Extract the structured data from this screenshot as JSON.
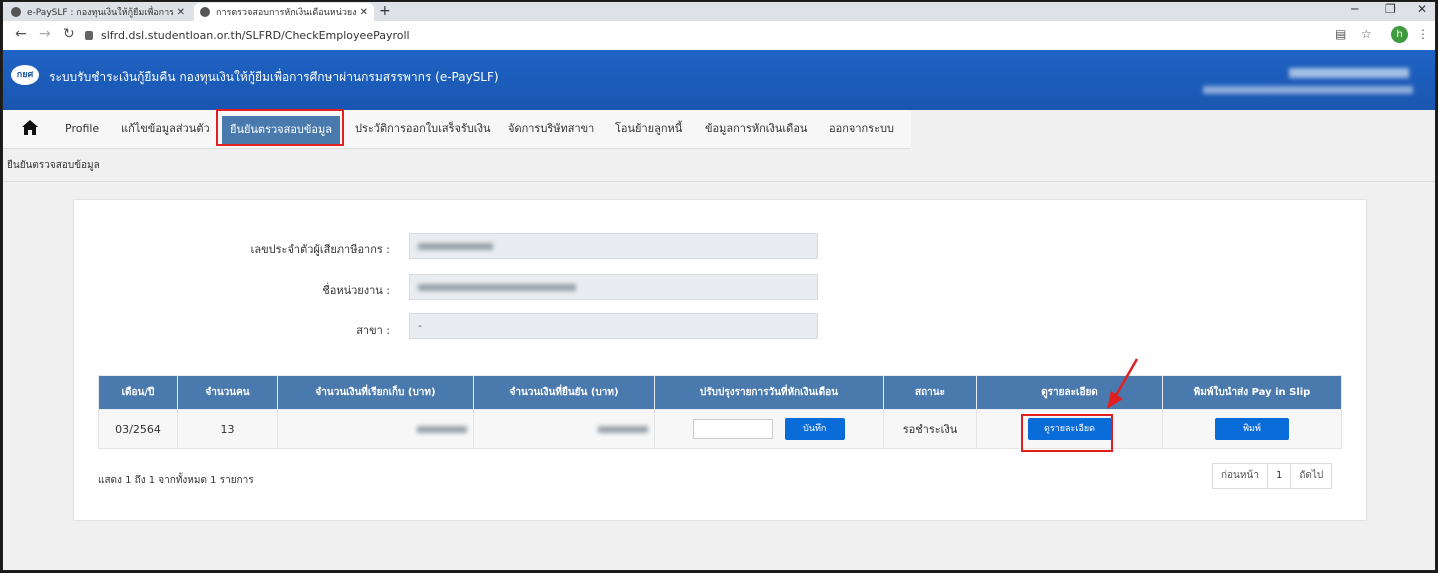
{
  "browser": {
    "tabs": [
      {
        "title": "e-PaySLF : กองทุนเงินให้กู้ยืมเพื่อการศึ"
      },
      {
        "title": "การตรวจสอบการหักเงินเดือนหน่วยงาน"
      }
    ],
    "new_tab": "+",
    "url": "slfrd.dsl.studentloan.or.th/SLFRD/CheckEmployeePayroll",
    "profile_initial": "h"
  },
  "header": {
    "logo_text": "กยศ",
    "title": "ระบบรับชำระเงินกู้ยืมคืน กองทุนเงินให้กู้ยืมเพื่อการศึกษาผ่านกรมสรรพากร (e-PaySLF)"
  },
  "nav": {
    "items": [
      {
        "label": "Profile"
      },
      {
        "label": "แก้ไขข้อมูลส่วนตัว"
      },
      {
        "label": "ยืนยันตรวจสอบข้อมูล"
      },
      {
        "label": "ประวัติการออกใบเสร็จรับเงิน"
      },
      {
        "label": "จัดการบริษัทสาขา"
      },
      {
        "label": "โอนย้ายลูกหนี้"
      },
      {
        "label": "ข้อมูลการหักเงินเดือน"
      },
      {
        "label": "ออกจากระบบ"
      }
    ]
  },
  "breadcrumb": "ยืนยันตรวจสอบข้อมูล",
  "form": {
    "tax_id_label": "เลขประจำตัวผู้เสียภาษีอากร :",
    "org_name_label": "ชื่อหน่วยงาน :",
    "branch_label": "สาขา :",
    "branch_value": "-"
  },
  "table": {
    "headers": [
      "เดือน/ปี",
      "จำนวนคน",
      "จำนวนเงินที่เรียกเก็บ (บาท)",
      "จำนวนเงินที่ยืนยัน (บาท)",
      "ปรับปรุงรายการวันที่หักเงินเดือน",
      "สถานะ",
      "ดูรายละเอียด",
      "พิมพ์ใบนำส่ง Pay in Slip"
    ],
    "rows": [
      {
        "month_year": "03/2564",
        "people": "13",
        "save_label": "บันทึก",
        "status": "รอชำระเงิน",
        "detail_label": "ดูรายละเอียด",
        "print_label": "พิมพ์"
      }
    ]
  },
  "summary": "แสดง 1 ถึง 1 จากทั้งหมด 1 รายการ",
  "pager": {
    "prev": "ก่อนหน้า",
    "current": "1",
    "next": "ถัดไป"
  },
  "colors": {
    "header": "#1e5fbf",
    "nav_active": "#4a7aad",
    "button": "#0a6cd8",
    "highlight": "#e02020"
  }
}
